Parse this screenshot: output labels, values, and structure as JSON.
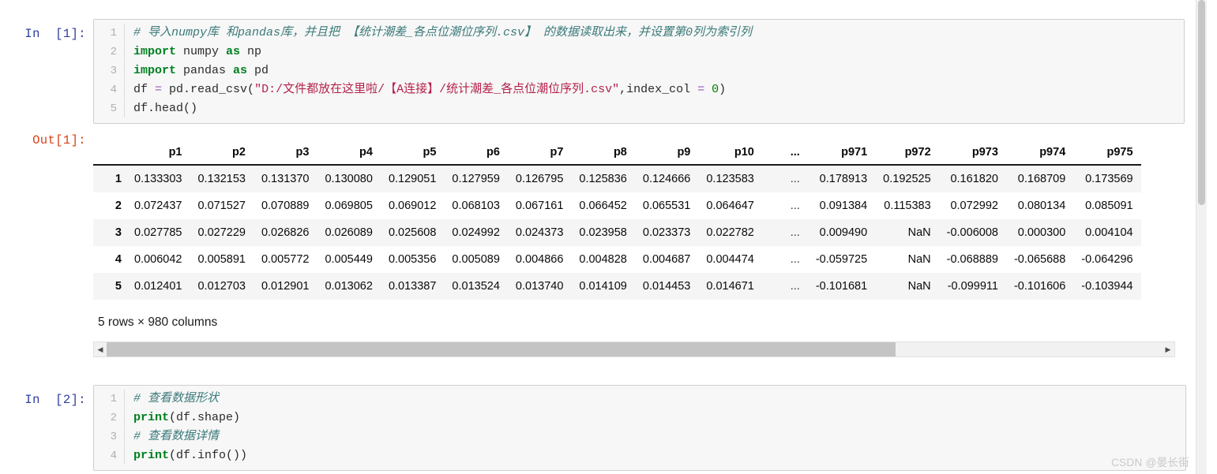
{
  "notebook": {
    "cells": [
      {
        "prompt": "In  [1]:",
        "type": "code",
        "lines": [
          {
            "n": "1",
            "tokens": [
              {
                "t": "comment",
                "s": "# 导入numpy库 和pandas库，并且把 【统计潮差_各点位潮位序列.csv】 的数据读取出来，并设置第0列为索引列"
              }
            ]
          },
          {
            "n": "2",
            "tokens": [
              {
                "t": "kw",
                "s": "import"
              },
              {
                "t": "name",
                "s": " numpy "
              },
              {
                "t": "kw",
                "s": "as"
              },
              {
                "t": "name",
                "s": " np"
              }
            ]
          },
          {
            "n": "3",
            "tokens": [
              {
                "t": "kw",
                "s": "import"
              },
              {
                "t": "name",
                "s": " pandas "
              },
              {
                "t": "kw",
                "s": "as"
              },
              {
                "t": "name",
                "s": " pd"
              }
            ]
          },
          {
            "n": "4",
            "tokens": [
              {
                "t": "name",
                "s": "df "
              },
              {
                "t": "op",
                "s": "="
              },
              {
                "t": "name",
                "s": " pd.read_csv("
              },
              {
                "t": "str",
                "s": "\"D:/文件都放在这里啦/【A连接】/统计潮差_各点位潮位序列.csv\""
              },
              {
                "t": "name",
                "s": ",index_col "
              },
              {
                "t": "op",
                "s": "="
              },
              {
                "t": "num",
                "s": " 0"
              },
              {
                "t": "name",
                "s": ")"
              }
            ]
          },
          {
            "n": "5",
            "tokens": [
              {
                "t": "name",
                "s": "df.head()"
              }
            ]
          }
        ]
      },
      {
        "prompt": "Out[1]:",
        "type": "output"
      },
      {
        "prompt": "In  [2]:",
        "type": "code",
        "lines": [
          {
            "n": "1",
            "tokens": [
              {
                "t": "comment",
                "s": "# 查看数据形状"
              }
            ]
          },
          {
            "n": "2",
            "tokens": [
              {
                "t": "kw",
                "s": "print"
              },
              {
                "t": "name",
                "s": "(df.shape)"
              }
            ]
          },
          {
            "n": "3",
            "tokens": [
              {
                "t": "comment",
                "s": "# 查看数据详情"
              }
            ]
          },
          {
            "n": "4",
            "tokens": [
              {
                "t": "kw",
                "s": "print"
              },
              {
                "t": "name",
                "s": "(df.info())"
              }
            ]
          }
        ]
      }
    ]
  },
  "dataframe": {
    "index_header": "",
    "columns": [
      "p1",
      "p2",
      "p3",
      "p4",
      "p5",
      "p6",
      "p7",
      "p8",
      "p9",
      "p10",
      "...",
      "p971",
      "p972",
      "p973",
      "p974",
      "p975"
    ],
    "index": [
      "1",
      "2",
      "3",
      "4",
      "5"
    ],
    "rows": [
      [
        "0.133303",
        "0.132153",
        "0.131370",
        "0.130080",
        "0.129051",
        "0.127959",
        "0.126795",
        "0.125836",
        "0.124666",
        "0.123583",
        "...",
        "0.178913",
        "0.192525",
        "0.161820",
        "0.168709",
        "0.173569"
      ],
      [
        "0.072437",
        "0.071527",
        "0.070889",
        "0.069805",
        "0.069012",
        "0.068103",
        "0.067161",
        "0.066452",
        "0.065531",
        "0.064647",
        "...",
        "0.091384",
        "0.115383",
        "0.072992",
        "0.080134",
        "0.085091"
      ],
      [
        "0.027785",
        "0.027229",
        "0.026826",
        "0.026089",
        "0.025608",
        "0.024992",
        "0.024373",
        "0.023958",
        "0.023373",
        "0.022782",
        "...",
        "0.009490",
        "NaN",
        "-0.006008",
        "0.000300",
        "0.004104"
      ],
      [
        "0.006042",
        "0.005891",
        "0.005772",
        "0.005449",
        "0.005356",
        "0.005089",
        "0.004866",
        "0.004828",
        "0.004687",
        "0.004474",
        "...",
        "-0.059725",
        "NaN",
        "-0.068889",
        "-0.065688",
        "-0.064296"
      ],
      [
        "0.012401",
        "0.012703",
        "0.012901",
        "0.013062",
        "0.013387",
        "0.013524",
        "0.013740",
        "0.014109",
        "0.014453",
        "0.014671",
        "...",
        "-0.101681",
        "NaN",
        "-0.099911",
        "-0.101606",
        "-0.103944"
      ]
    ],
    "shape_text": "5 rows × 980 columns",
    "scrollbar": {
      "left_arrow": "◀",
      "right_arrow": "▶",
      "thumb_percent": "74.8"
    }
  },
  "watermark": {
    "text": "CSDN @晏长街"
  },
  "colors": {
    "cell_background": "#f7f7f7",
    "cell_border": "#cfcfcf",
    "in_prompt": "#303f9f",
    "out_prompt": "#d84315",
    "comment": "#3c7a7a",
    "keyword": "#007f20",
    "string": "#b3224b",
    "number": "#008000",
    "operator": "#9b59b6",
    "row_stripe": "#f5f5f5"
  }
}
